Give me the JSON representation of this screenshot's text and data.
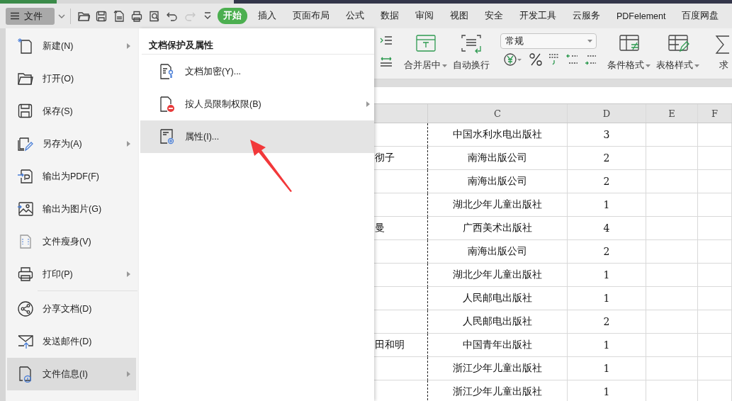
{
  "toolbar": {
    "file_button": {
      "label": "文件"
    },
    "quick_access": [
      {
        "disabled": false
      },
      {
        "disabled": false
      },
      {
        "disabled": false
      },
      {
        "disabled": false
      },
      {
        "disabled": false
      },
      {
        "disabled": false
      },
      {
        "disabled": true
      },
      {
        "disabled": false
      }
    ]
  },
  "tabs": [
    {
      "label": "开始",
      "selected": true
    },
    {
      "label": "插入",
      "selected": false
    },
    {
      "label": "页面布局",
      "selected": false
    },
    {
      "label": "公式",
      "selected": false
    },
    {
      "label": "数据",
      "selected": false
    },
    {
      "label": "审阅",
      "selected": false
    },
    {
      "label": "视图",
      "selected": false
    },
    {
      "label": "安全",
      "selected": false
    },
    {
      "label": "开发工具",
      "selected": false
    },
    {
      "label": "云服务",
      "selected": false
    },
    {
      "label": "PDFelement",
      "selected": false
    },
    {
      "label": "百度网盘",
      "selected": false
    }
  ],
  "ribbon": {
    "items": [
      {
        "kind": "indent"
      },
      {
        "kind": "button",
        "label": "合并居中",
        "has_menu": true
      },
      {
        "kind": "button",
        "label": "自动换行",
        "has_menu": false
      },
      {
        "kind": "separator"
      },
      {
        "kind": "number_format",
        "value": "常规"
      },
      {
        "kind": "separator"
      },
      {
        "kind": "button",
        "label": "条件格式",
        "has_menu": true
      },
      {
        "kind": "button",
        "label": "表格样式",
        "has_menu": true
      },
      {
        "kind": "separator"
      },
      {
        "kind": "button",
        "label": "求",
        "has_menu": false
      }
    ]
  },
  "sheet": {
    "columns": [
      "C",
      "D",
      "E",
      "F"
    ],
    "rows": [
      {
        "C": "中国水利水电出版社",
        "D": "3"
      },
      {
        "B": "彻子",
        "C": "南海出版公司",
        "D": "2"
      },
      {
        "C": "南海出版公司",
        "D": "2"
      },
      {
        "C": "湖北少年儿童出版社",
        "D": "1"
      },
      {
        "B": "曼",
        "C": "广西美术出版社",
        "D": "4"
      },
      {
        "C": "南海出版公司",
        "D": "2"
      },
      {
        "C": "湖北少年儿童出版社",
        "D": "1"
      },
      {
        "C": "人民邮电出版社",
        "D": "1"
      },
      {
        "C": "人民邮电出版社",
        "D": "2"
      },
      {
        "B": "田和明",
        "C": "中国青年出版社",
        "D": "1"
      },
      {
        "C": "浙江少年儿童出版社",
        "D": "1"
      },
      {
        "C": "浙江少年儿童出版社",
        "D": "1"
      }
    ]
  },
  "file_menu": {
    "items": [
      {
        "label": "新建(N)",
        "has_submenu": true,
        "selected": false,
        "separator_before": false
      },
      {
        "label": "打开(O)",
        "has_submenu": false,
        "selected": false,
        "separator_before": false
      },
      {
        "label": "保存(S)",
        "has_submenu": false,
        "selected": false,
        "separator_before": false
      },
      {
        "label": "另存为(A)",
        "has_submenu": true,
        "selected": false,
        "separator_before": false
      },
      {
        "label": "输出为PDF(F)",
        "has_submenu": false,
        "selected": false,
        "separator_before": false
      },
      {
        "label": "输出为图片(G)",
        "has_submenu": false,
        "selected": false,
        "separator_before": false
      },
      {
        "label": "文件瘦身(V)",
        "has_submenu": false,
        "selected": false,
        "separator_before": false
      },
      {
        "label": "打印(P)",
        "has_submenu": true,
        "selected": false,
        "separator_before": false
      },
      {
        "label": "分享文档(D)",
        "has_submenu": false,
        "selected": false,
        "separator_before": true
      },
      {
        "label": "发送邮件(D)",
        "has_submenu": false,
        "selected": false,
        "separator_before": false
      },
      {
        "label": "文件信息(I)",
        "has_submenu": true,
        "selected": true,
        "separator_before": false
      }
    ]
  },
  "submenu": {
    "title": "文档保护及属性",
    "items": [
      {
        "label": "文档加密(Y)...",
        "has_submenu": false,
        "selected": false
      },
      {
        "label": "按人员限制权限(B)",
        "has_submenu": true,
        "selected": false
      },
      {
        "label": "属性(I)...",
        "has_submenu": false,
        "selected": true
      }
    ]
  }
}
